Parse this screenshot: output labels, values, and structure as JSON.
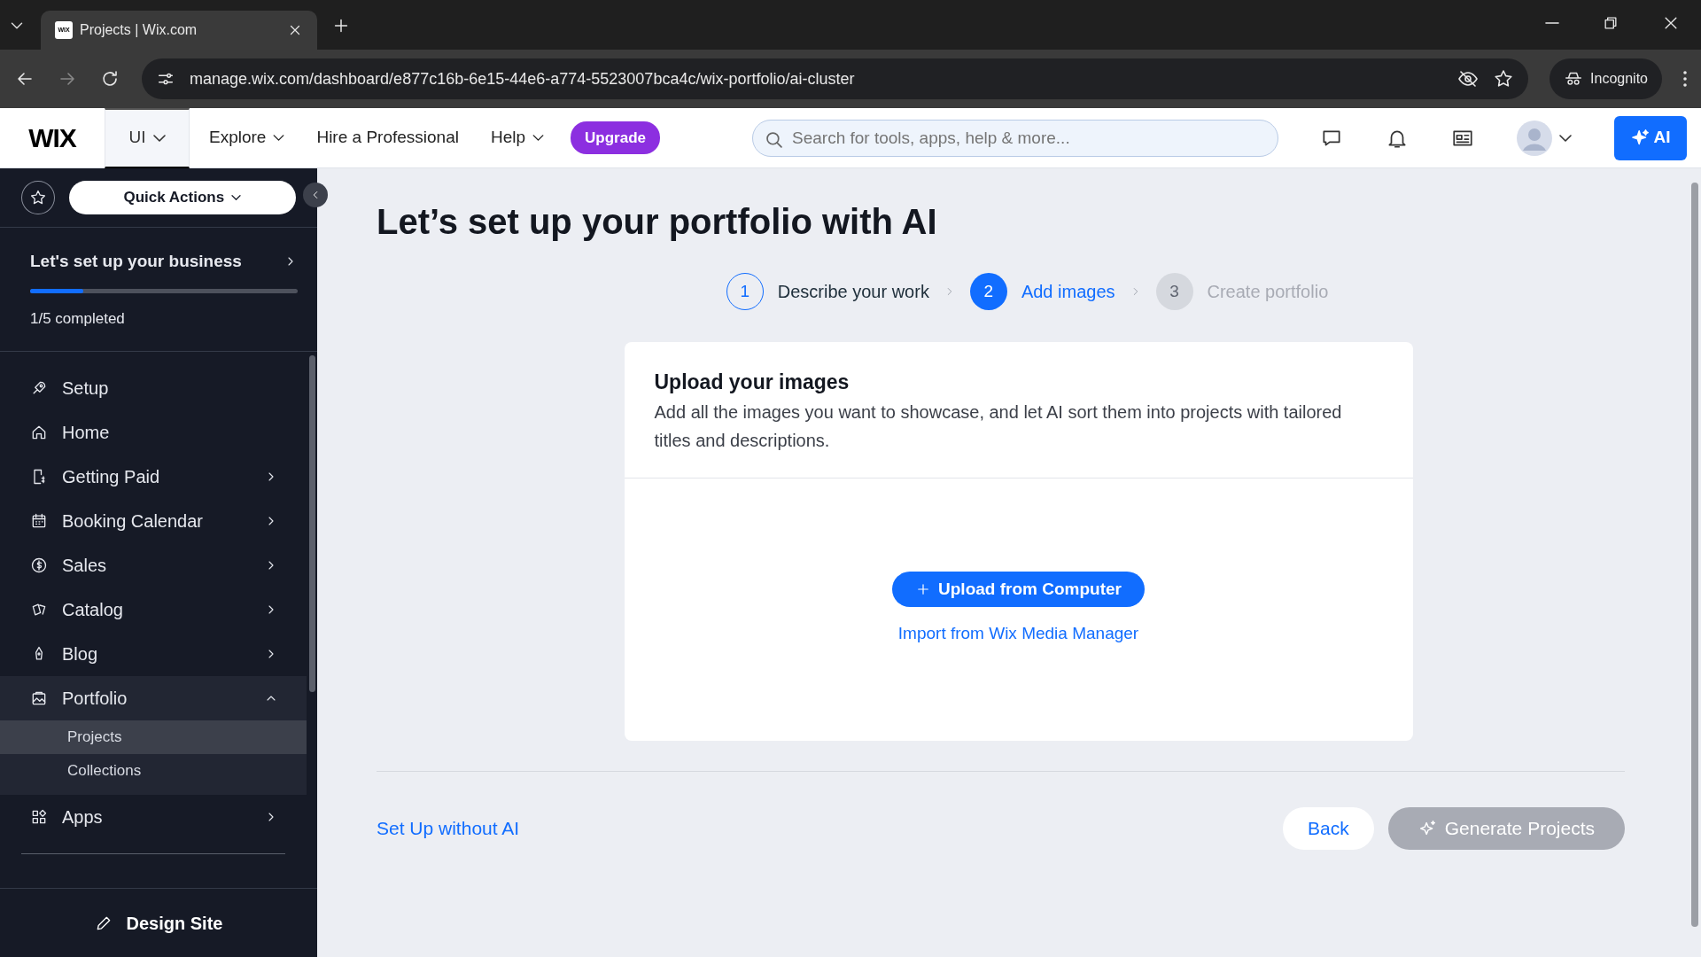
{
  "browser": {
    "tab": {
      "title": "Projects | Wix.com",
      "favicon": "WIX"
    },
    "url": "manage.wix.com/dashboard/e877c16b-6e15-44e6-a774-5523007bca4c/wix-portfolio/ai-cluster",
    "profile": "Incognito"
  },
  "topbar": {
    "logo": "WIX",
    "site_menu": "UI",
    "menus": [
      {
        "label": "Explore",
        "dropdown": true
      },
      {
        "label": "Hire a Professional",
        "dropdown": false
      },
      {
        "label": "Help",
        "dropdown": true
      }
    ],
    "upgrade": "Upgrade",
    "search": {
      "placeholder": "Search for tools, apps, help & more..."
    },
    "ai_button": "AI"
  },
  "sidebar": {
    "quick_actions": "Quick Actions",
    "setup_card": {
      "title": "Let's set up your business",
      "level": 0.2,
      "progress_text": "1/5 completed"
    },
    "items": [
      {
        "label": "Setup",
        "has_arrow": false
      },
      {
        "label": "Home",
        "has_arrow": false
      },
      {
        "label": "Getting Paid",
        "has_arrow": true
      },
      {
        "label": "Booking Calendar",
        "has_arrow": true
      },
      {
        "label": "Sales",
        "has_arrow": true
      },
      {
        "label": "Catalog",
        "has_arrow": true
      },
      {
        "label": "Blog",
        "has_arrow": true
      },
      {
        "label": "Portfolio",
        "has_arrow": true,
        "expanded": true,
        "children": [
          {
            "label": "Projects",
            "selected": true
          },
          {
            "label": "Collections",
            "selected": false
          }
        ]
      },
      {
        "label": "Apps",
        "has_arrow": true
      }
    ],
    "footer_button": "Design Site"
  },
  "main": {
    "title": "Let’s set up your portfolio with AI",
    "steps": [
      {
        "number": "1",
        "label": "Describe your work",
        "kind": "done"
      },
      {
        "number": "2",
        "label": "Add images",
        "kind": "current"
      },
      {
        "number": "3",
        "label": "Create portfolio",
        "kind": "upcoming"
      }
    ],
    "card": {
      "title": "Upload your images",
      "description": "Add all the images you want to showcase, and let AI sort them into projects with tailored titles and descriptions.",
      "upload_button": "Upload from Computer",
      "import_link": "Import from Wix Media Manager"
    },
    "setup_without_ai": "Set Up without AI",
    "back_button": "Back",
    "generate_button": {
      "label": "Generate Projects",
      "disabled": true
    }
  }
}
